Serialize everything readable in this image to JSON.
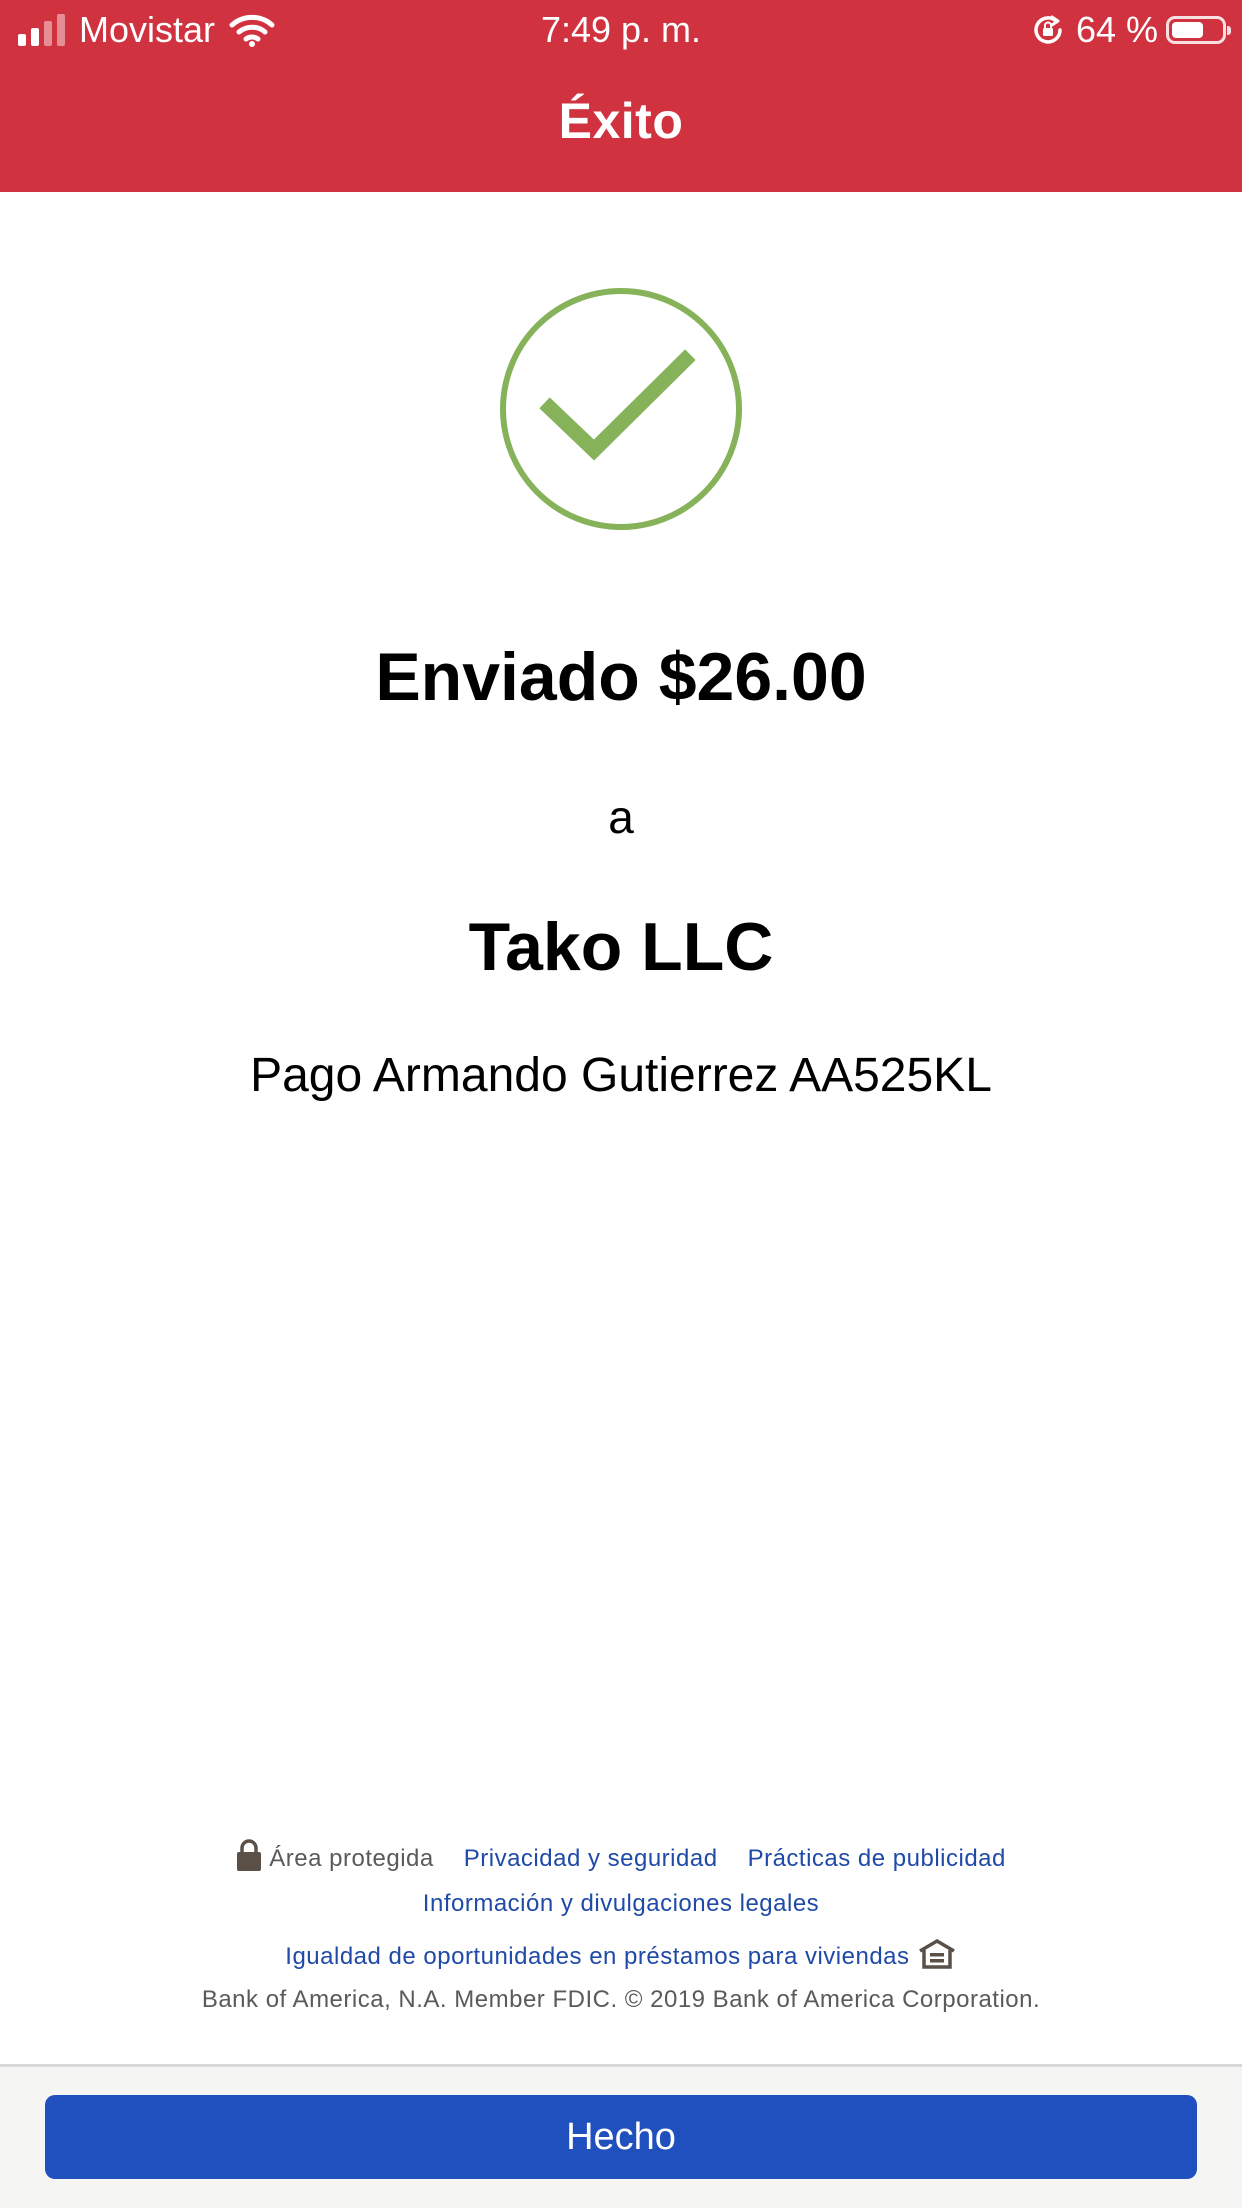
{
  "status_bar": {
    "carrier": "Movistar",
    "time": "7:49 p. m.",
    "battery_percent": "64 %",
    "battery_level": 0.64
  },
  "header": {
    "title": "Éxito"
  },
  "confirmation": {
    "amount_line": "Enviado $26.00",
    "connector": "a",
    "recipient": "Tako LLC",
    "memo": "Pago Armando Gutierrez AA525KL"
  },
  "footer": {
    "secure_area": "Área protegida",
    "privacy_link": "Privacidad y seguridad",
    "advertising_link": "Prácticas de publicidad",
    "legal_link": "Información y divulgaciones legales",
    "equal_housing_link": "Igualdad de oportunidades en préstamos para viviendas",
    "copyright": "Bank of America, N.A. Member FDIC. © 2019 Bank of America Corporation."
  },
  "actions": {
    "done_label": "Hecho"
  },
  "colors": {
    "header_bg": "#d03240",
    "success_green": "#86b25a",
    "link_blue": "#1f4aa8",
    "button_blue": "#2050bd"
  },
  "icons": {
    "success": "check-circle-icon",
    "lock": "lock-icon",
    "housing": "equal-housing-icon",
    "wifi": "wifi-icon",
    "rotation_lock": "rotation-lock-icon"
  }
}
